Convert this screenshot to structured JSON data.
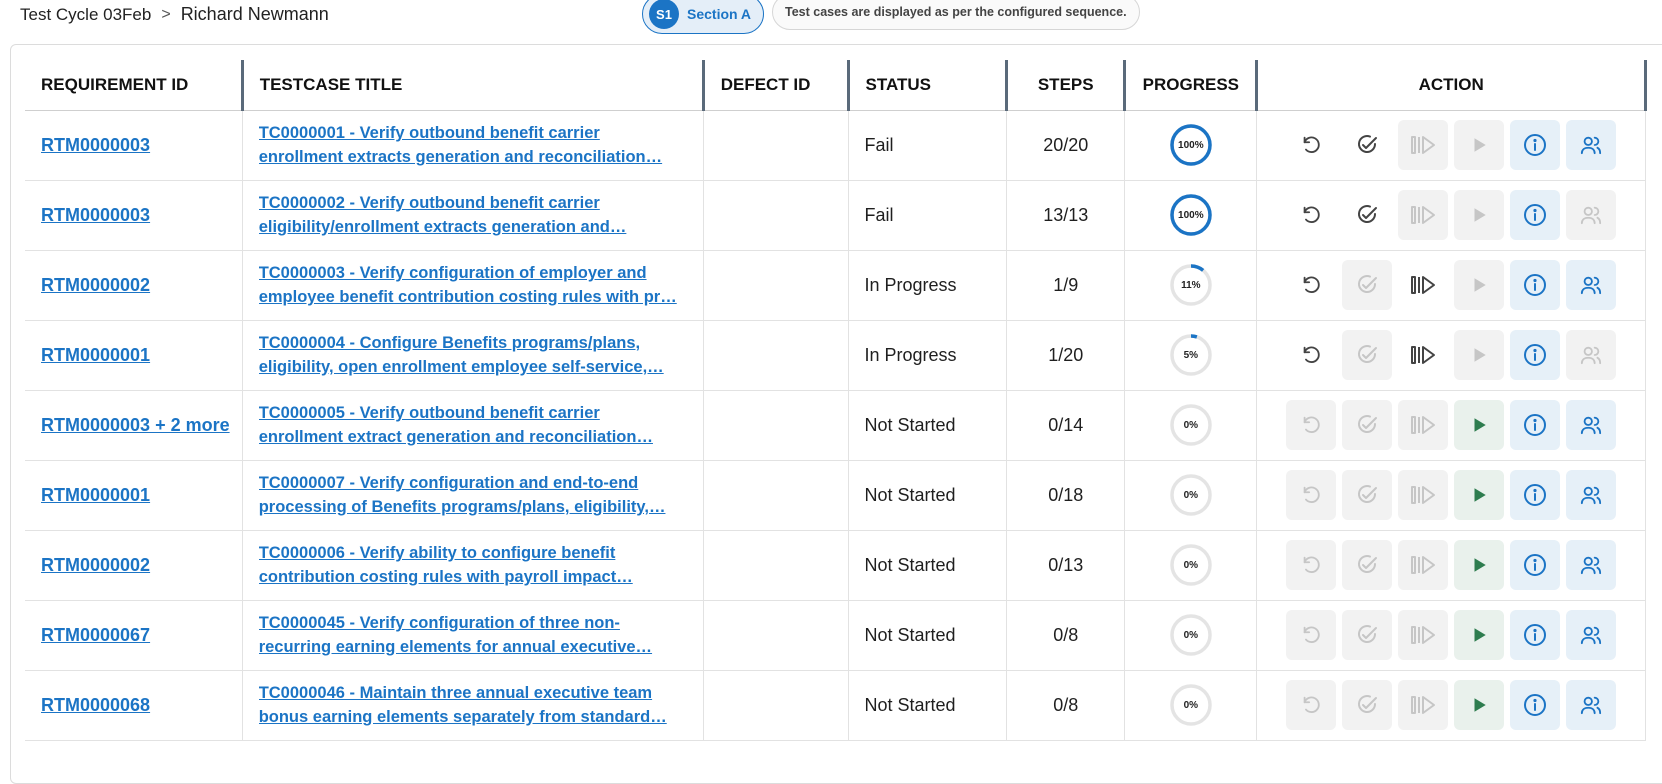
{
  "header": {
    "cycle": "Test Cycle 03Feb",
    "separator": ">",
    "user": "Richard Newmann",
    "section_badge": "S1",
    "section_label": "Section A",
    "note": "Test cases are displayed as per the configured sequence."
  },
  "columns": [
    "REQUIREMENT ID",
    "TESTCASE TITLE",
    "DEFECT ID",
    "STATUS",
    "STEPS",
    "PROGRESS",
    "ACTION"
  ],
  "rows": [
    {
      "req": "RTM0000003",
      "title": "TC0000001 - Verify outbound benefit carrier enrollment extracts generation and reconciliation…",
      "defect": "",
      "status": "Fail",
      "steps": "20/20",
      "progress": 100,
      "progress_label": "100%",
      "reset": true,
      "complete": true,
      "resume": false,
      "start": false,
      "assign": true
    },
    {
      "req": "RTM0000003",
      "title": "TC0000002 - Verify outbound benefit carrier eligibility/enrollment extracts generation and…",
      "defect": "",
      "status": "Fail",
      "steps": "13/13",
      "progress": 100,
      "progress_label": "100%",
      "reset": true,
      "complete": true,
      "resume": false,
      "start": false,
      "assign": false
    },
    {
      "req": "RTM0000002",
      "title": "TC0000003 - Verify configuration of employer and employee benefit contribution costing rules with pr…",
      "defect": "",
      "status": "In Progress",
      "steps": "1/9",
      "progress": 11,
      "progress_label": "11%",
      "reset": true,
      "complete": false,
      "resume": true,
      "start": false,
      "assign": true
    },
    {
      "req": "RTM0000001",
      "title": "TC0000004 - Configure Benefits programs/plans, eligibility, open enrollment employee self-service,…",
      "defect": "",
      "status": "In Progress",
      "steps": "1/20",
      "progress": 5,
      "progress_label": "5%",
      "reset": true,
      "complete": false,
      "resume": true,
      "start": false,
      "assign": false
    },
    {
      "req": "RTM0000003 + 2 more",
      "title": "TC0000005 - Verify outbound benefit carrier enrollment extract generation and reconciliation…",
      "defect": "",
      "status": "Not Started",
      "steps": "0/14",
      "progress": 0,
      "progress_label": "0%",
      "reset": false,
      "complete": false,
      "resume": false,
      "start": true,
      "assign": true
    },
    {
      "req": "RTM0000001",
      "title": "TC0000007 - Verify configuration and end-to-end processing of Benefits programs/plans, eligibility,…",
      "defect": "",
      "status": "Not Started",
      "steps": "0/18",
      "progress": 0,
      "progress_label": "0%",
      "reset": false,
      "complete": false,
      "resume": false,
      "start": true,
      "assign": true
    },
    {
      "req": "RTM0000002",
      "title": "TC0000006 - Verify ability to configure benefit contribution costing rules with payroll impact…",
      "defect": "",
      "status": "Not Started",
      "steps": "0/13",
      "progress": 0,
      "progress_label": "0%",
      "reset": false,
      "complete": false,
      "resume": false,
      "start": true,
      "assign": true
    },
    {
      "req": "RTM0000067",
      "title": "TC0000045 - Verify configuration of three non-recurring earning elements for annual executive…",
      "defect": "",
      "status": "Not Started",
      "steps": "0/8",
      "progress": 0,
      "progress_label": "0%",
      "reset": false,
      "complete": false,
      "resume": false,
      "start": true,
      "assign": true
    },
    {
      "req": "RTM0000068",
      "title": "TC0000046 - Maintain three annual executive team bonus earning elements separately from standard…",
      "defect": "",
      "status": "Not Started",
      "steps": "0/8",
      "progress": 0,
      "progress_label": "0%",
      "reset": false,
      "complete": false,
      "resume": false,
      "start": true,
      "assign": true
    }
  ],
  "icons": {
    "reset": "reset-icon",
    "complete": "check-circle-icon",
    "resume": "resume-icon",
    "start": "play-icon",
    "info": "info-icon",
    "assign": "users-icon"
  },
  "colors": {
    "accent": "#1b74c5",
    "play": "#2e7d4f",
    "disabled": "#c6c6c6",
    "active_icon": "#444444"
  }
}
